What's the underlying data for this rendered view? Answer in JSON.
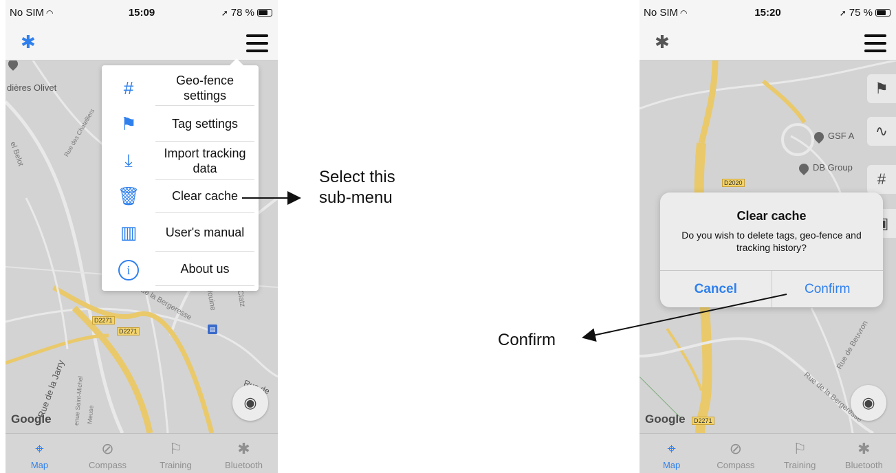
{
  "left_phone": {
    "status": {
      "carrier": "No SIM",
      "time": "15:09",
      "battery": "78 %"
    },
    "map_labels": [
      "dières Olivet",
      "el Belot",
      "Rue des Chatelliers",
      "D2271",
      "D2271",
      "de la Bergeresse",
      "la Jouine",
      "des Clatz",
      "Rue de la Jarry",
      "enue Saint-Michel",
      "Meuse",
      "Rue de"
    ],
    "google": "Google",
    "menu": [
      {
        "icon": "geo-fence-icon",
        "label": "Geo-fence settings"
      },
      {
        "icon": "flag-icon",
        "label": "Tag settings"
      },
      {
        "icon": "download-icon",
        "label": "Import tracking data"
      },
      {
        "icon": "trash-icon",
        "label": "Clear cache"
      },
      {
        "icon": "manual-icon",
        "label": "User's manual"
      },
      {
        "icon": "info-icon",
        "label": "About us"
      }
    ],
    "tabs": [
      {
        "icon": "map-pin-icon",
        "label": "Map"
      },
      {
        "icon": "compass-icon",
        "label": "Compass"
      },
      {
        "icon": "flag-icon",
        "label": "Training"
      },
      {
        "icon": "bluetooth-icon",
        "label": "Bluetooth"
      }
    ]
  },
  "right_phone": {
    "status": {
      "carrier": "No SIM",
      "time": "15:20",
      "battery": "75 %"
    },
    "map_labels": [
      "D2020",
      "GSF A",
      "DB Group",
      "Rue de Beuvron",
      "Rue de la Bergeresse",
      "D2271"
    ],
    "google": "Google",
    "dialog": {
      "title": "Clear cache",
      "message": "Do you wish to delete tags, geo-fence and tracking history?",
      "cancel": "Cancel",
      "confirm": "Confirm"
    },
    "tabs": [
      {
        "icon": "map-pin-icon",
        "label": "Map"
      },
      {
        "icon": "compass-icon",
        "label": "Compass"
      },
      {
        "icon": "flag-icon",
        "label": "Training"
      },
      {
        "icon": "bluetooth-icon",
        "label": "Bluetooth"
      }
    ]
  },
  "annotations": {
    "select_line1": "Select this",
    "select_line2": "sub-menu",
    "confirm": "Confirm"
  },
  "colors": {
    "accent": "#2f80ed",
    "road": "#e9c96a",
    "map_bg": "#d3d3d3"
  }
}
